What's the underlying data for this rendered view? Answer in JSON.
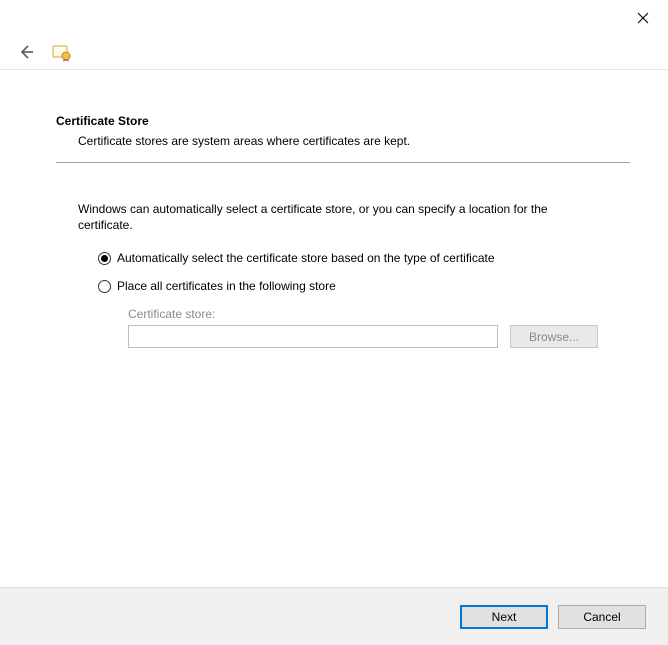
{
  "header": {
    "title": "Certificate Store",
    "subtitle": "Certificate stores are system areas where certificates are kept."
  },
  "body": {
    "intro": "Windows can automatically select a certificate store, or you can specify a location for the certificate.",
    "radio_auto": "Automatically select the certificate store based on the type of certificate",
    "radio_manual": "Place all certificates in the following store",
    "store_label": "Certificate store:",
    "store_value": "",
    "browse_label": "Browse..."
  },
  "footer": {
    "next_label": "Next",
    "cancel_label": "Cancel"
  }
}
